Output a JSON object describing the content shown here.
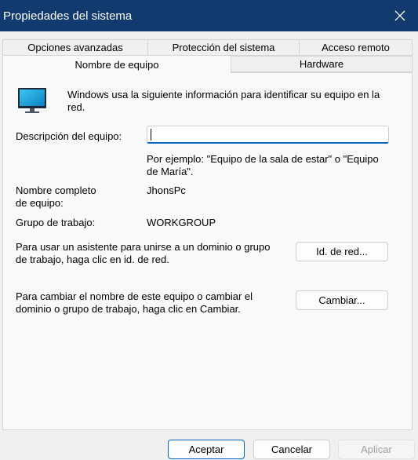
{
  "window": {
    "title": "Propiedades del sistema",
    "close_icon": "close-icon"
  },
  "tabs_row1": [
    "Opciones avanzadas",
    "Protección del sistema",
    "Acceso remoto"
  ],
  "tabs_row2": [
    "Nombre de equipo",
    "Hardware"
  ],
  "active_tab": "Nombre de equipo",
  "info": {
    "icon": "monitor-icon",
    "line1": "Windows usa la siguiente información para identificar su equipo en la",
    "line2": "red."
  },
  "description": {
    "label": "Descripción del equipo:",
    "value": "",
    "hint_line1": "Por ejemplo: \"Equipo de la sala de estar\" o \"Equipo",
    "hint_line2": "de María\"."
  },
  "full_name": {
    "label_line1": "Nombre completo",
    "label_line2": "de equipo:",
    "value": "JhonsPc"
  },
  "workgroup": {
    "label": "Grupo de trabajo:",
    "value": "WORKGROUP"
  },
  "network_id": {
    "text_line1": "Para usar un asistente para unirse a un dominio o grupo",
    "text_line2": "de trabajo, haga clic en id. de red.",
    "button": "Id. de red..."
  },
  "change": {
    "text_line1": "Para cambiar el nombre de este equipo o cambiar el",
    "text_line2": "dominio o grupo de trabajo, haga clic en Cambiar.",
    "button": "Cambiar..."
  },
  "footer": {
    "ok": "Aceptar",
    "cancel": "Cancelar",
    "apply": "Aplicar"
  },
  "colors": {
    "titlebar": "#113b6e",
    "accent": "#0067c0",
    "panel": "#f9f9f9"
  }
}
